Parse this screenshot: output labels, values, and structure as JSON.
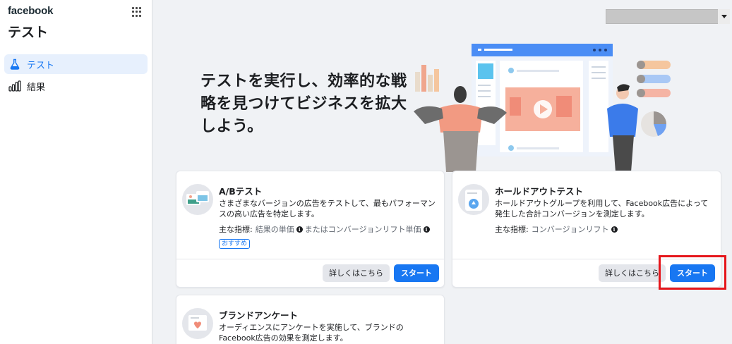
{
  "sidebar": {
    "brand": "facebook",
    "title": "テスト",
    "items": [
      {
        "label": "テスト",
        "icon": "flask-icon",
        "active": true
      },
      {
        "label": "結果",
        "icon": "bar-chart-icon",
        "active": false
      }
    ]
  },
  "hero": {
    "title": "テストを実行し、効率的な戦略を見つけてビジネスを拡大しよう。"
  },
  "cards": [
    {
      "title": "A/Bテスト",
      "description": "さまざまなバージョンの広告をテストして、最もパフォーマンスの高い広告を特定します。",
      "metric_label": "主な指標:",
      "metric_value_1": "結果の単価",
      "metric_sep": "または",
      "metric_value_2": "コンバージョンリフト単価",
      "badge": "おすすめ",
      "more_label": "詳しくはこちら",
      "start_label": "スタート"
    },
    {
      "title": "ホールドアウトテスト",
      "description": "ホールドアウトグループを利用して、Facebook広告によって発生した合計コンバージョンを測定します。",
      "metric_label": "主な指標:",
      "metric_value_1": "コンバージョンリフト",
      "more_label": "詳しくはこちら",
      "start_label": "スタート"
    },
    {
      "title": "ブランドアンケート",
      "description": "オーディエンスにアンケートを実施して、ブランドのFacebook広告の効果を測定します。"
    }
  ],
  "colors": {
    "accent": "#1877f2",
    "highlight": "#e5161b"
  }
}
